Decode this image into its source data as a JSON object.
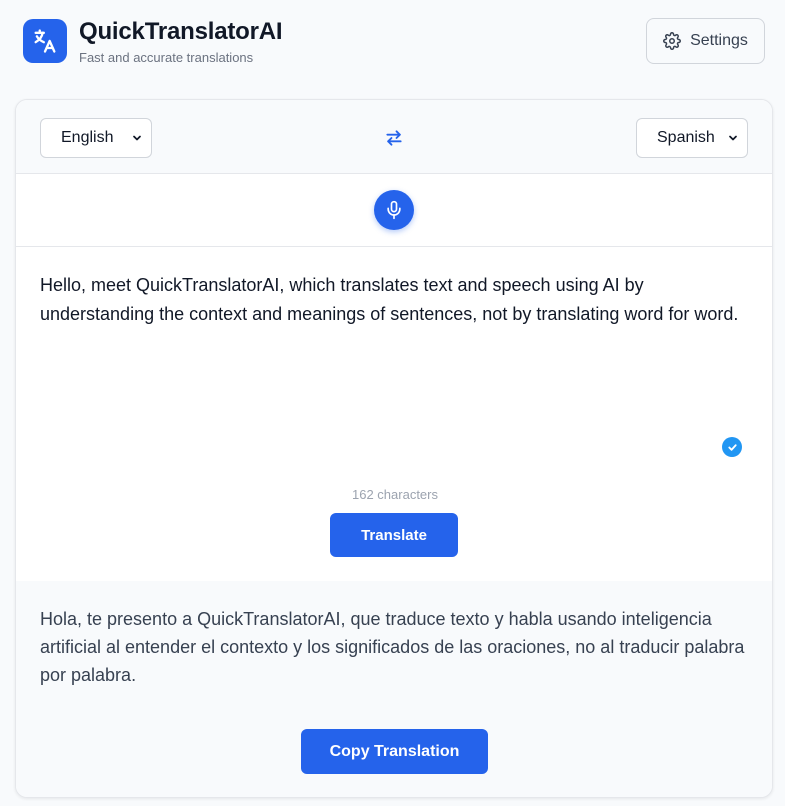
{
  "app": {
    "title": "QuickTranslatorAI",
    "subtitle": "Fast and accurate translations",
    "logo_icon": "translate-icon",
    "accent_color": "#2563eb"
  },
  "header": {
    "settings_label": "Settings",
    "settings_icon": "gear-icon"
  },
  "languages": {
    "source": "English",
    "target": "Spanish",
    "swap_icon": "swap-arrows-icon"
  },
  "input": {
    "mic_icon": "microphone-icon",
    "text": "Hello, meet QuickTranslatorAI, which translates text and speech using AI by understanding the context and meanings of sentences, not by translating word for word.",
    "status_icon": "check-circle-icon",
    "char_count": "162 characters",
    "translate_label": "Translate"
  },
  "output": {
    "text": "Hola, te presento a QuickTranslatorAI, que traduce texto y habla usando inteligencia artificial al entender el contexto y los significados de las oraciones, no al traducir palabra por palabra.",
    "copy_label": "Copy Translation"
  }
}
